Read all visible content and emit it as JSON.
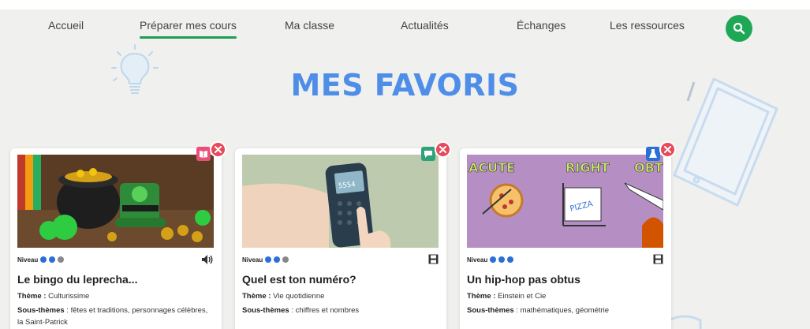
{
  "nav": {
    "items": [
      {
        "label": "Accueil"
      },
      {
        "label": "Préparer mes cours"
      },
      {
        "label": "Ma classe"
      },
      {
        "label": "Actualités"
      },
      {
        "label": "Échanges"
      },
      {
        "label": "Les ressources"
      }
    ],
    "active_index": 1,
    "search_icon": "search-icon"
  },
  "page": {
    "title": "MES FAVORIS"
  },
  "common": {
    "level_label": "Niveau",
    "theme_label": "Thème :",
    "subthemes_label": "Sous-thèmes"
  },
  "cards": [
    {
      "title": "Le bingo du leprecha...",
      "level": 2,
      "level_max": 3,
      "media_icon": "audio-icon",
      "type_icon": "book-icon",
      "type_color": "#e8507a",
      "theme": "Culturissime",
      "subthemes": " : fêtes et traditions, personnages célèbres, la Saint-Patrick",
      "thumb_tag": ""
    },
    {
      "title": "Quel est ton numéro?",
      "level": 2,
      "level_max": 3,
      "media_icon": "video-icon",
      "type_icon": "chat-icon",
      "type_color": "#2fa27a",
      "theme": "Vie quotidienne",
      "subthemes": " : chiffres et nombres",
      "thumb_tag": "5554"
    },
    {
      "title": "Un hip-hop pas obtus",
      "level": 3,
      "level_max": 3,
      "media_icon": "video-icon",
      "type_icon": "flask-icon",
      "type_color": "#2a6fd6",
      "theme": "Einstein et Cie",
      "subthemes": " : mathématiques, géométrie",
      "thumb_tag": "ACUTE",
      "thumb_tag2": "RIGHT",
      "thumb_tag3": "OBTU",
      "thumb_tag4": "PIZZA"
    }
  ],
  "colors": {
    "accent_green": "#1ea856",
    "title_blue": "#4f8ee8",
    "remove_red": "#e64b5b",
    "level_dot": "#2a6fd6"
  }
}
